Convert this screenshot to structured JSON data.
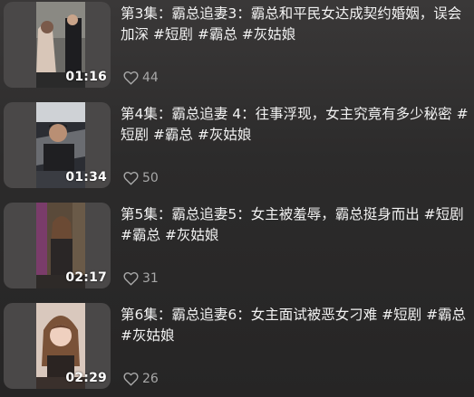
{
  "episodes": [
    {
      "title": "第3集：霸总追妻3：霸总和平民女达成契约婚姻，误会加深 #短剧 #霸总 #灰姑娘",
      "duration": "01:16",
      "likes": "44"
    },
    {
      "title": "第4集：霸总追妻 4：往事浮现，女主究竟有多少秘密 #短剧 #霸总 #灰姑娘",
      "duration": "01:34",
      "likes": "50"
    },
    {
      "title": "第5集：霸总追妻5：女主被羞辱，霸总挺身而出 #短剧 #霸总 #灰姑娘",
      "duration": "02:17",
      "likes": "31"
    },
    {
      "title": "第6集：霸总追妻6：女主面试被恶女刁难 #短剧 #霸总 #灰姑娘",
      "duration": "02:29",
      "likes": "26"
    }
  ],
  "icons": {
    "like": "heart-outline-icon"
  },
  "colors": {
    "title_text": "#f2f2f2",
    "meta_text": "#a8a8a8",
    "thumb_bg": "#4a4848"
  }
}
